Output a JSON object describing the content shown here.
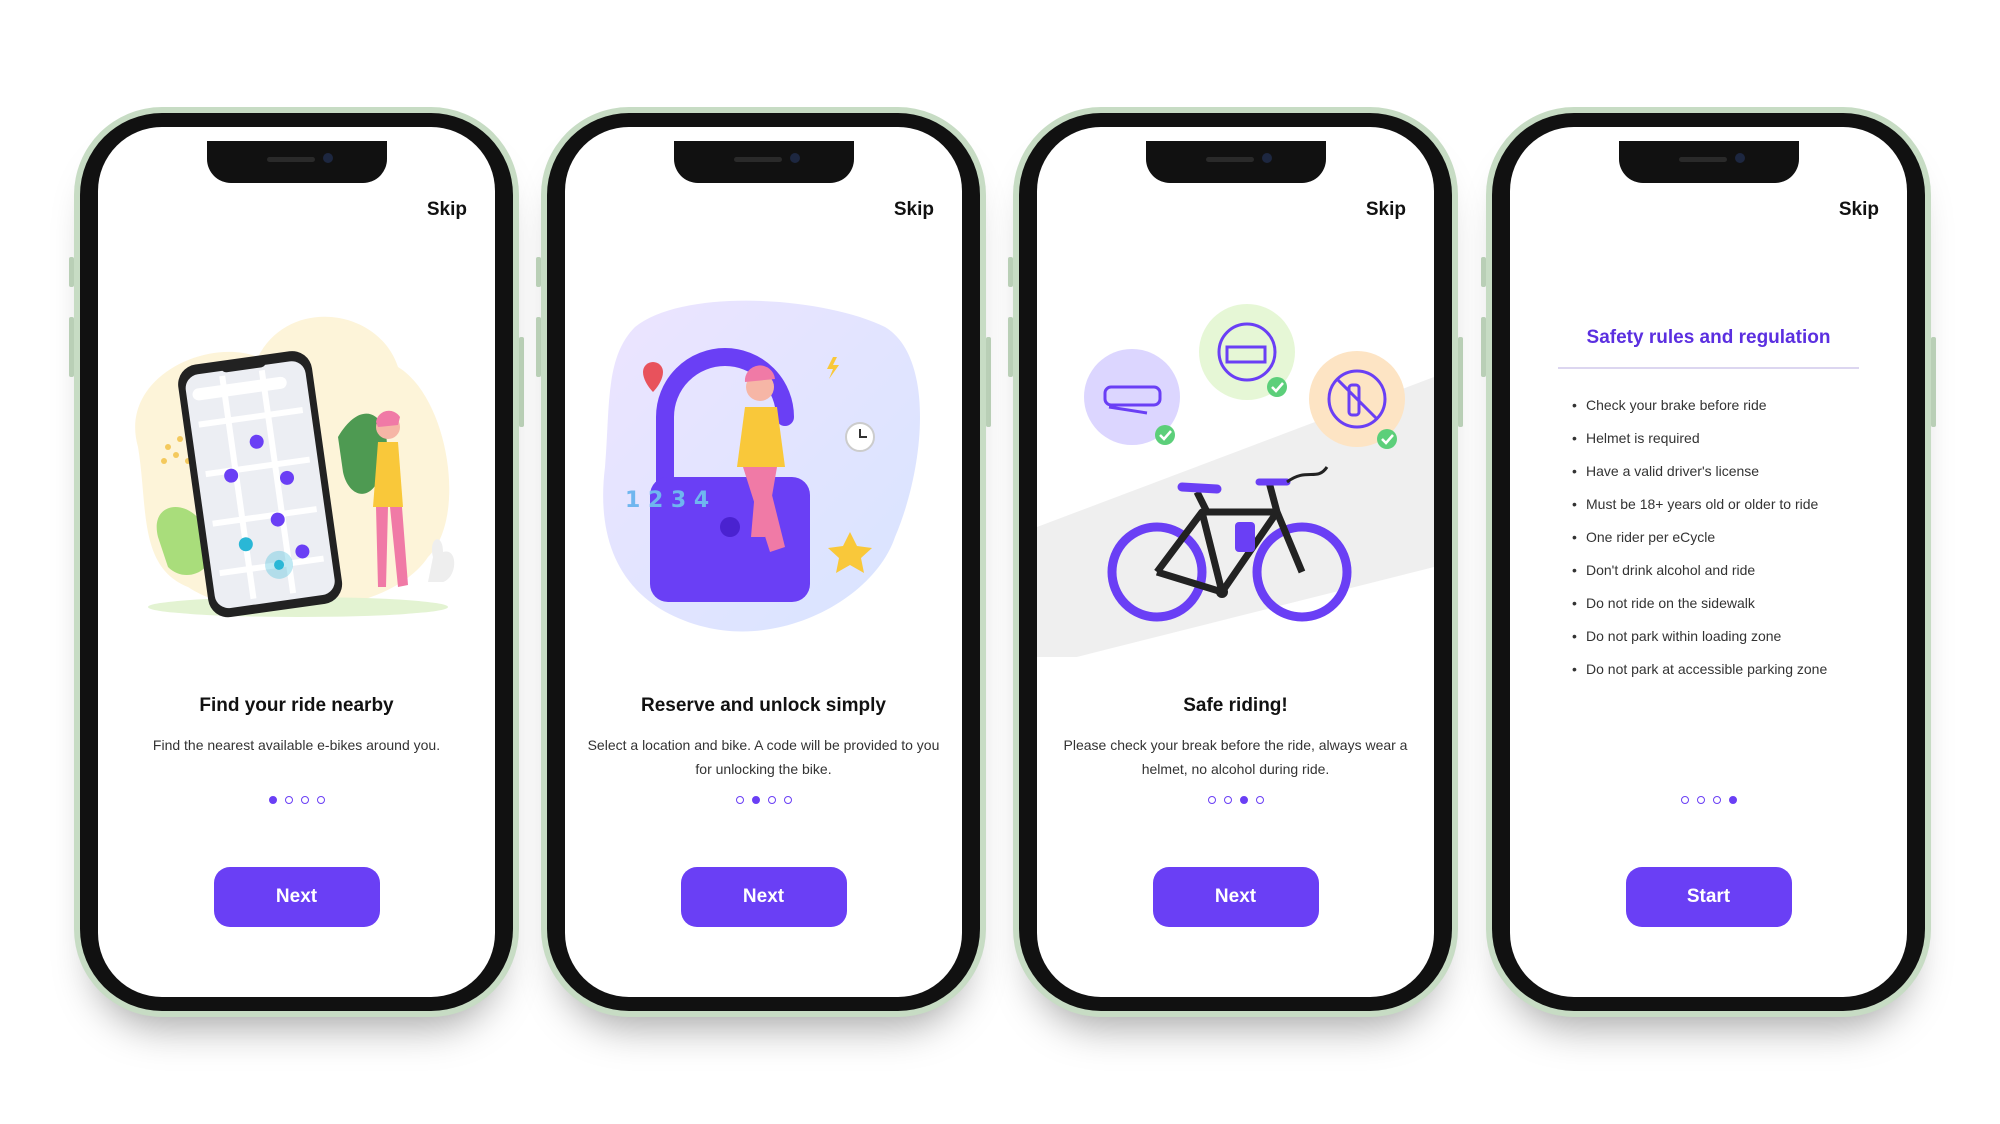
{
  "colors": {
    "accent": "#6a3ff5",
    "rules_title": "#5b2fe0"
  },
  "screens": [
    {
      "skip": "Skip",
      "title": "Find your ride nearby",
      "description": "Find the nearest available e-bikes around you.",
      "page_indicator": {
        "current": 1,
        "total": 4
      },
      "button": "Next",
      "illustration": "phone-map-illustration"
    },
    {
      "skip": "Skip",
      "title": "Reserve and unlock simply",
      "description": "Select a location and bike. A code will be provided to you for unlocking the bike.",
      "page_indicator": {
        "current": 2,
        "total": 4
      },
      "button": "Next",
      "illustration": "unlock-padlock-illustration"
    },
    {
      "skip": "Skip",
      "title": "Safe riding!",
      "description": "Please check your break before the ride, always wear a helmet, no alcohol during ride.",
      "page_indicator": {
        "current": 3,
        "total": 4
      },
      "button": "Next",
      "illustration": "ebike-safety-illustration"
    },
    {
      "skip": "Skip",
      "title": "Safety rules and regulation",
      "rules": [
        "Check your brake before ride",
        "Helmet is required",
        "Have a valid driver's license",
        "Must be 18+ years old or older to ride",
        "One rider per eCycle",
        "Don't drink alcohol and ride",
        "Do not ride on the sidewalk",
        "Do not park within loading zone",
        "Do not park at accessible parking zone"
      ],
      "page_indicator": {
        "current": 4,
        "total": 4
      },
      "button": "Start"
    }
  ]
}
